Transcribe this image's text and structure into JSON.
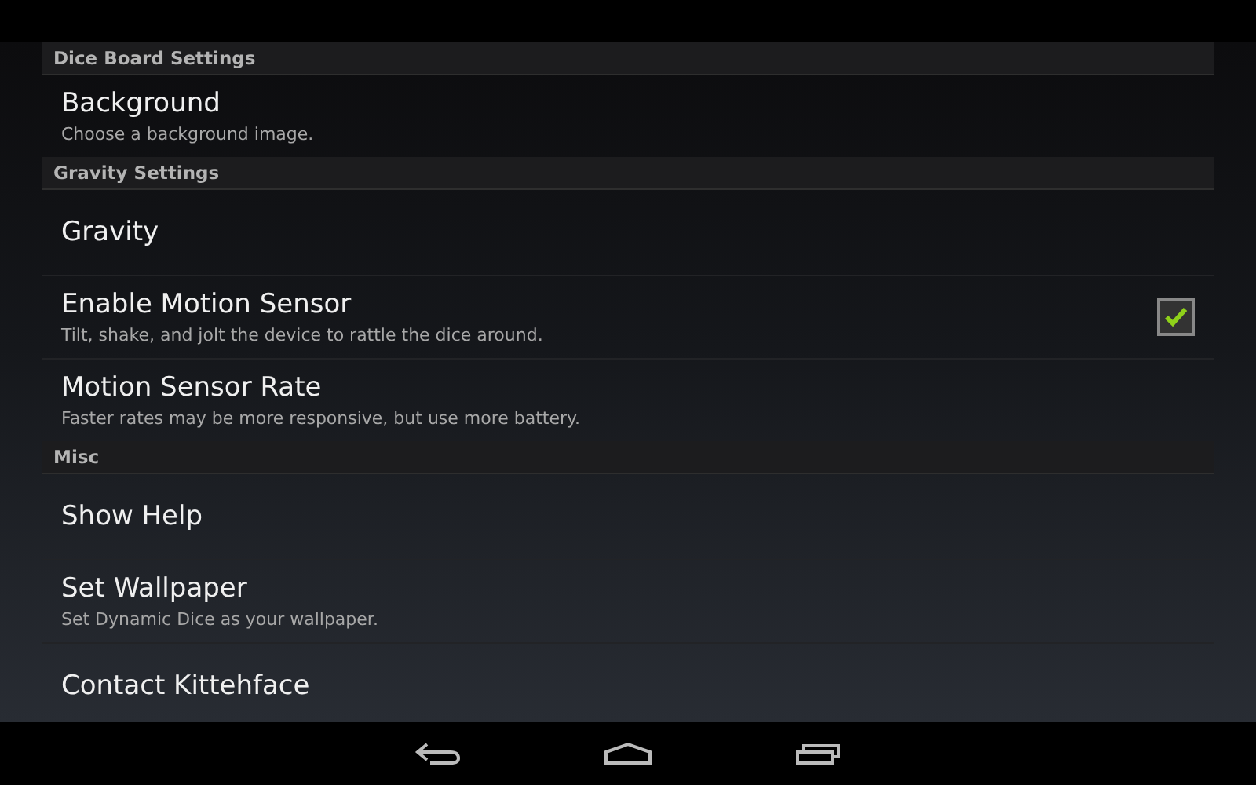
{
  "sections": [
    {
      "title": "Dice Board Settings",
      "items": [
        {
          "kind": "plain",
          "title": "Background",
          "summary": "Choose a background image."
        }
      ]
    },
    {
      "title": "Gravity Settings",
      "items": [
        {
          "kind": "plain",
          "title": "Gravity"
        },
        {
          "kind": "checkbox",
          "title": "Enable Motion Sensor",
          "summary": "Tilt, shake, and jolt the device to rattle the dice around.",
          "checked": true
        },
        {
          "kind": "plain",
          "title": "Motion Sensor Rate",
          "summary": "Faster rates may be more responsive, but use more battery."
        }
      ]
    },
    {
      "title": "Misc",
      "items": [
        {
          "kind": "plain",
          "title": "Show Help"
        },
        {
          "kind": "plain",
          "title": "Set Wallpaper",
          "summary": "Set Dynamic Dice as your wallpaper."
        },
        {
          "kind": "plain",
          "title": "Contact Kittehface"
        }
      ]
    }
  ]
}
